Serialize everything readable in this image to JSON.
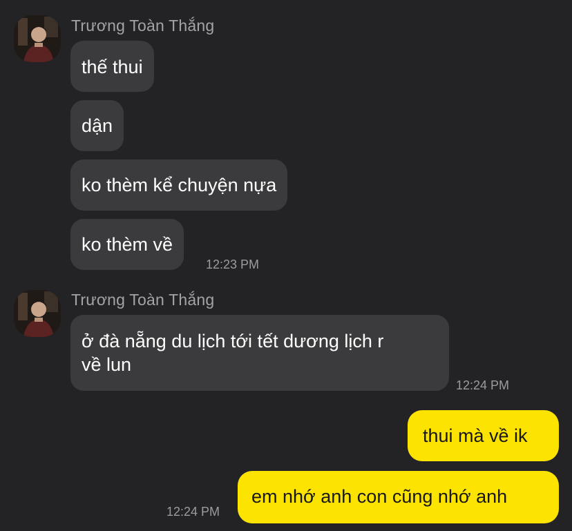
{
  "chat": {
    "groups": [
      {
        "sender_name": "Trương Toàn Thắng",
        "avatar": "avatar-photo",
        "messages": [
          "thế thui",
          "dận",
          "ko thèm kể chuyện nựa",
          "ko thèm về"
        ],
        "time": "12:23 PM"
      },
      {
        "sender_name": "Trương Toàn Thắng",
        "avatar": "avatar-photo",
        "messages": [
          [
            "ở đà nẵng du lịch tới tết dương lịch r",
            "về lun"
          ]
        ],
        "time": "12:24 PM"
      }
    ],
    "outgoing": {
      "messages": [
        "thui mà về ik",
        "em nhớ anh con cũng nhớ anh"
      ],
      "time": "12:24 PM"
    }
  },
  "colors": {
    "background": "#232325",
    "incoming_bubble": "#3b3b3d",
    "outgoing_bubble": "#fde400",
    "sender_text": "#a4a4a8",
    "timestamp_text": "#9c9ca0"
  }
}
